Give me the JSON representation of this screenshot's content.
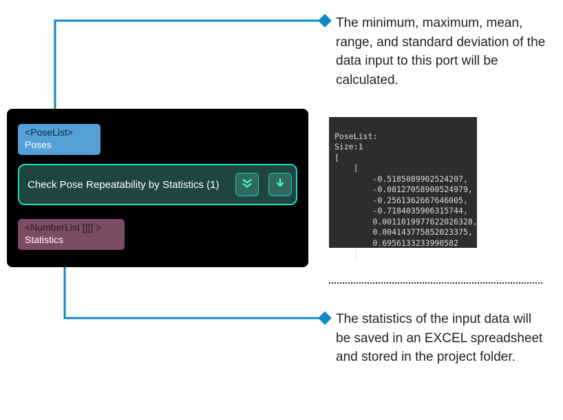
{
  "colors": {
    "accent": "#0f88c3",
    "node_outline": "#19e0c5"
  },
  "annotations": {
    "top": "The minimum, maximum, mean, range, and standard deviation of the data input to this port will be calculated.",
    "bottom": "The statistics of the input data will be saved in an EXCEL spreadsheet and stored in the project folder."
  },
  "node": {
    "input_port": {
      "type": "<PoseList>",
      "name": "Poses"
    },
    "step_label": "Check Pose Repeatability by Statistics (1)",
    "output_port": {
      "type": "<NumberList [][] >",
      "name": "Statistics"
    }
  },
  "icons": {
    "expand": "expand-all-icon",
    "run": "run-icon"
  },
  "dump": {
    "heading": "PoseList:",
    "size_label": "Size:1",
    "values": [
      "-0.5185089902524207",
      "-0.08127058900524979",
      "-0.2561362667646005",
      "-0.7184035906315744",
      "0.0011019977622026328",
      "0.004143775852023375",
      "0.6956133233990582"
    ]
  }
}
